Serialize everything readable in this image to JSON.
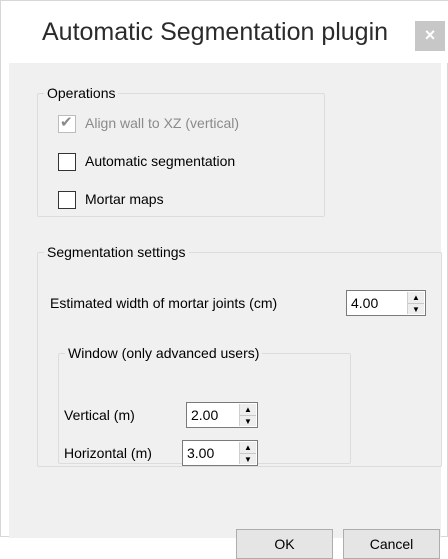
{
  "window": {
    "title": "Automatic Segmentation plugin",
    "close_glyph": "×"
  },
  "operations": {
    "legend": "Operations",
    "items": [
      {
        "label": "Align wall to XZ (vertical)",
        "checked": true,
        "enabled": false
      },
      {
        "label": "Automatic segmentation",
        "checked": false,
        "enabled": true
      },
      {
        "label": "Mortar maps",
        "checked": false,
        "enabled": true
      }
    ]
  },
  "segmentation": {
    "legend": "Segmentation settings",
    "mortar_label": "Estimated width of mortar joints (cm)",
    "mortar_value": "4.00",
    "window": {
      "legend": "Window (only advanced users)",
      "vertical_label": "Vertical (m)",
      "vertical_value": "2.00",
      "horizontal_label": "Horizontal (m)",
      "horizontal_value": "3.00"
    }
  },
  "buttons": {
    "ok": "OK",
    "cancel": "Cancel"
  },
  "icons": {
    "checkmark": "checkmark-icon",
    "spin_up": "arrow-up-icon",
    "spin_down": "arrow-down-icon",
    "close": "close-icon"
  }
}
